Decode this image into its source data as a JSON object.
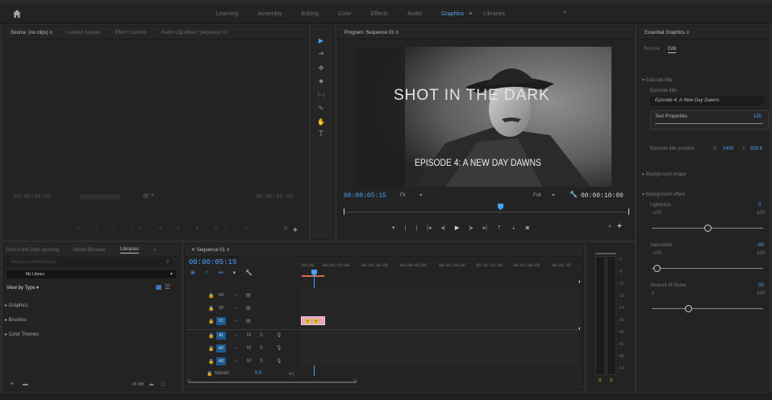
{
  "workspace": {
    "tabs": [
      "Learning",
      "Assembly",
      "Editing",
      "Color",
      "Effects",
      "Audio",
      "Graphics",
      "Libraries"
    ],
    "active": "Graphics",
    "active_menu_glyph": "≡",
    "more": "»"
  },
  "source_panel": {
    "tabs": [
      "Source: (no clips)",
      "Lumetri Scopes",
      "Effect Controls",
      "Audio Clip Mixer: Sequence 01"
    ],
    "tab_menu_glyph": "≡",
    "timecode_left": "00;00;00;00",
    "timecode_right": "00;00;00;00"
  },
  "tools": [
    "▶",
    "⇥",
    "✥",
    "⬥",
    "|↔|",
    "✎",
    "✋",
    "T"
  ],
  "program_panel": {
    "title": "Program: Sequence 01",
    "title_menu_glyph": "≡",
    "timecode": "00:00:05:15",
    "fit": "Fit",
    "full": "Full",
    "duration": "00:00:10:00",
    "video_title": "SHOT IN THE DARK",
    "video_subtitle": "EPISODE 4: A NEW DAY DAWNS"
  },
  "essential_graphics": {
    "title": "Essential Graphics",
    "title_menu_glyph": "≡",
    "tabs": [
      "Browse",
      "Edit"
    ],
    "active_tab": "Edit",
    "section_episode_title": "Episode title",
    "field_label": "Episode title",
    "field_value": "Episode 4: A New Day Dawns",
    "text_properties_label": "Text Properties",
    "text_properties_value": "120",
    "position_label": "Episode title position",
    "position_x_label": "X",
    "position_x": "1400",
    "position_y_label": "Y",
    "position_y": "926.6",
    "background_image_label": "Background image",
    "background_effect_label": "Background effect",
    "lightness_label": "Lightness",
    "lightness_value": "0",
    "lightness_min": "-100",
    "lightness_max": "100",
    "lightness_level": 0.5,
    "saturation_label": "Saturation",
    "saturation_value": "-99",
    "saturation_min": "-100",
    "saturation_max": "100",
    "saturation_level": 0.005,
    "noise_label": "Amount of Noise",
    "noise_value": "33",
    "noise_min": "1",
    "noise_max": "100",
    "noise_level": 0.33
  },
  "project_panel": {
    "tabs": [
      "Shot in the Dark opening",
      "Media Browser",
      "Libraries"
    ],
    "active_tab": "Libraries",
    "more": "»",
    "search_placeholder": "Search current library",
    "library": "My Library",
    "view_by": "View by Type",
    "items": [
      "Graphics",
      "Brushes",
      "Color Themes"
    ],
    "footer_size": "45 MB"
  },
  "timeline": {
    "tab": "Sequence 01",
    "tab_menu_glyph": "≡",
    "timecode": "00:00:05:15",
    "ruler": [
      "00;00",
      "00:00:15:00",
      "00:00:30:00",
      "00:00:45:00",
      "00:01:00:00",
      "00:01:15:00",
      "00:01:30:00",
      "00:01:45"
    ],
    "video_tracks": [
      "V3",
      "V2",
      "V1"
    ],
    "audio_tracks": [
      "A1",
      "A2",
      "A3"
    ],
    "master_label": "Master",
    "master_value": "0.0",
    "clip_labels": [
      "fx",
      "fx"
    ]
  },
  "audio_meter": {
    "labels": [
      "0",
      "-6",
      "-12",
      "-18",
      "-24",
      "-30",
      "-36",
      "-42",
      "-48",
      "-54"
    ],
    "footer": [
      "S",
      "S"
    ]
  },
  "colors": {
    "accent": "#4aa3ff",
    "panel": "#232323",
    "border_frame": "#cfa965",
    "clip": "#e7a2c6"
  }
}
